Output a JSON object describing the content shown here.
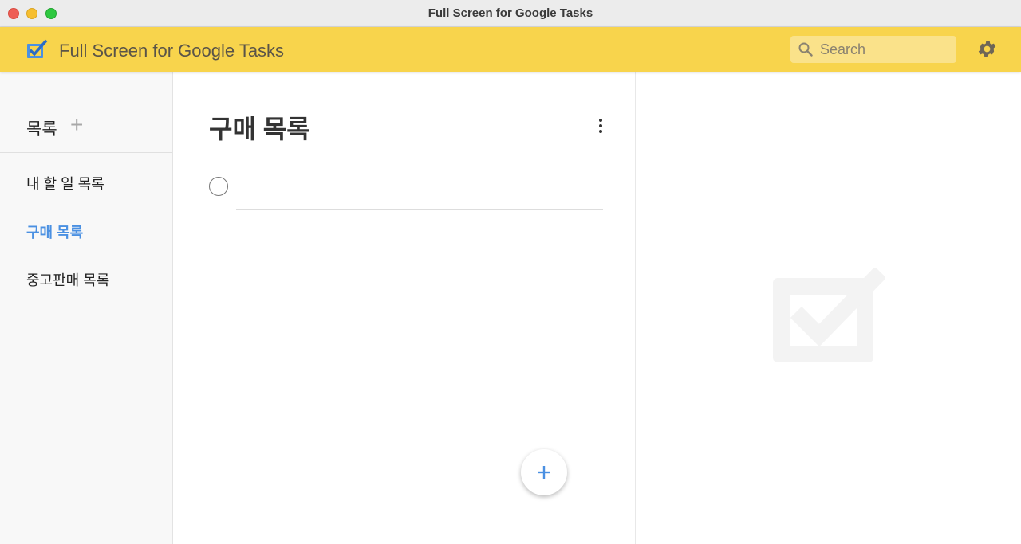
{
  "window": {
    "title": "Full Screen for Google Tasks"
  },
  "header": {
    "app_name": "Full Screen for Google Tasks",
    "logo_icon": "checkbox-logo-icon",
    "search": {
      "placeholder": "Search",
      "value": ""
    },
    "settings_icon": "gear-icon"
  },
  "sidebar": {
    "title": "목록",
    "add_icon": "+",
    "items": [
      {
        "label": "내 할 일 목록",
        "active": false
      },
      {
        "label": "구매 목록",
        "active": true
      },
      {
        "label": "중고판매 목록",
        "active": false
      }
    ]
  },
  "main": {
    "list_title": "구매 목록",
    "more_icon": "more-vert-icon",
    "new_task": {
      "value": ""
    },
    "add_task_icon": "plus-icon"
  },
  "detail": {
    "empty_icon": "checkbox-watermark-icon"
  },
  "colors": {
    "header_bg": "#f8d44c",
    "accent": "#4a90e2",
    "sidebar_bg": "#f8f8f8"
  }
}
